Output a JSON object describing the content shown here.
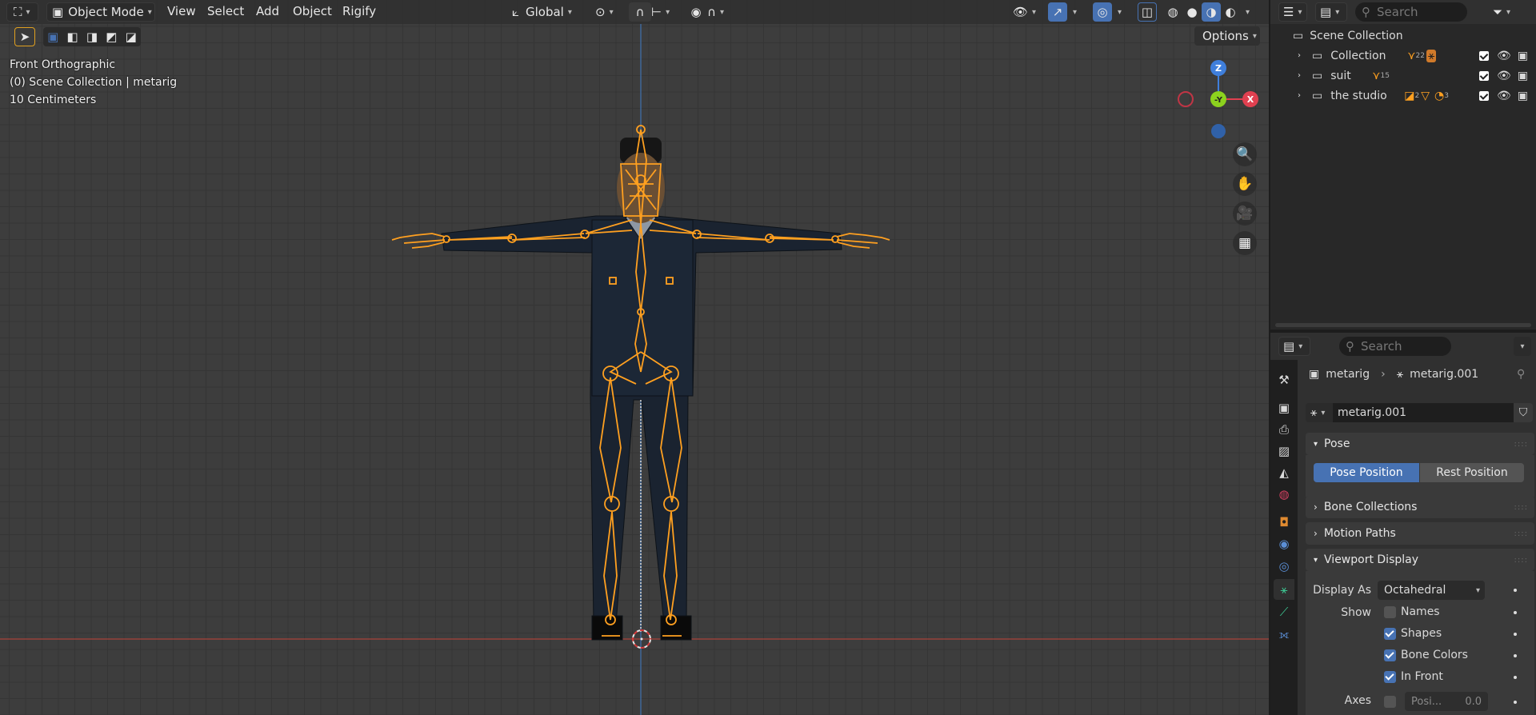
{
  "header": {
    "mode": "Object Mode",
    "menus": [
      "View",
      "Select",
      "Add",
      "Object",
      "Rigify"
    ],
    "transform_orientation": "Global",
    "options_label": "Options"
  },
  "overlay": {
    "view_name": "Front Orthographic",
    "collection": "(0) Scene Collection | metarig",
    "scale": "10 Centimeters"
  },
  "gizmo": {
    "z": "Z",
    "y": "-Y",
    "x": "X"
  },
  "colors": {
    "accent": "#4772b3",
    "bone": "#ffa020",
    "x_axis": "#e04050",
    "y_axis": "#8cd21e",
    "z_axis": "#3f7fdc"
  },
  "outliner": {
    "search_placeholder": "Search",
    "root": "Scene Collection",
    "rows": [
      {
        "label": "Collection",
        "badge1": "22"
      },
      {
        "label": "suit",
        "badge1": "15"
      },
      {
        "label": "the studio",
        "badge1": "2",
        "badge2": "3"
      }
    ]
  },
  "properties": {
    "search_placeholder": "Search",
    "breadcrumb_object": "metarig",
    "breadcrumb_data": "metarig.001",
    "data_name": "metarig.001",
    "pose_panel": "Pose",
    "pose_position": "Pose Position",
    "rest_position": "Rest Position",
    "bone_collections": "Bone Collections",
    "motion_paths": "Motion Paths",
    "viewport_display": "Viewport Display",
    "display_as_label": "Display As",
    "display_as_value": "Octahedral",
    "show_label": "Show",
    "names": "Names",
    "shapes": "Shapes",
    "bone_colors": "Bone Colors",
    "in_front": "In Front",
    "axes_label": "Axes",
    "axes_position_label": "Posi...",
    "axes_position_value": "0.0"
  }
}
